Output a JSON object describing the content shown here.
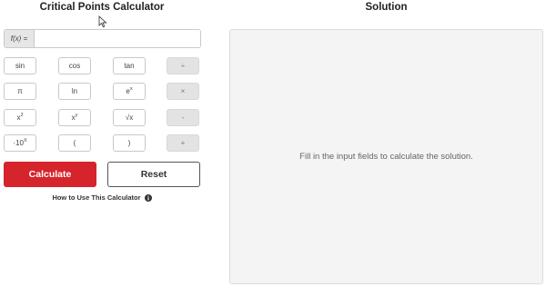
{
  "calculator": {
    "title": "Critical Points Calculator",
    "fx_label": "f(x) =",
    "input_value": "",
    "input_placeholder": "",
    "keys": {
      "sin": "sin",
      "cos": "cos",
      "tan": "tan",
      "divide": "÷",
      "pi": "π",
      "ln": "ln",
      "e_base": "e",
      "e_exp": "x",
      "multiply": "×",
      "x2_base": "x",
      "x2_exp": "2",
      "xy_base": "x",
      "xy_exp": "y",
      "sqrt": "√x",
      "minus": "-",
      "ten_base": "·10",
      "ten_exp": "X",
      "lparen": "(",
      "rparen": ")",
      "plus": "+"
    },
    "calculate_label": "Calculate",
    "reset_label": "Reset",
    "howto_label": "How to Use This Calculator",
    "colors": {
      "calculate_bg": "#d6242c",
      "operator_bg": "#e3e3e3"
    }
  },
  "solution": {
    "title": "Solution",
    "message": "Fill in the input fields to calculate the solution."
  },
  "icons": {
    "cursor": "mouse-pointer-icon",
    "info": "info-icon"
  }
}
